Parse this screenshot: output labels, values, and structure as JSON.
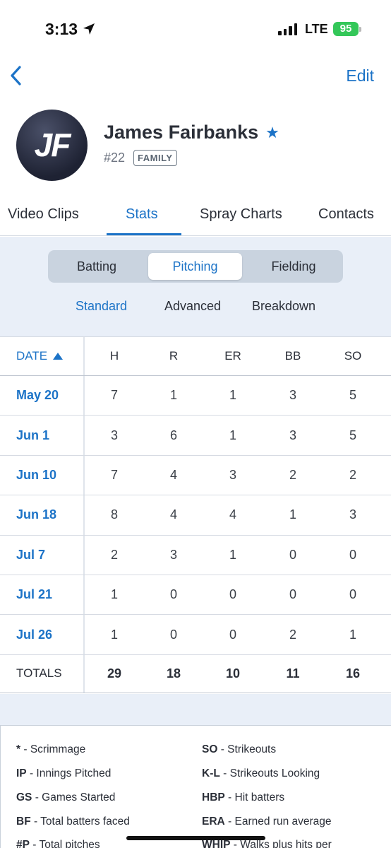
{
  "status_bar": {
    "time": "3:13",
    "network": "LTE",
    "battery": "95"
  },
  "nav": {
    "edit_label": "Edit"
  },
  "profile": {
    "initials": "JF",
    "name": "James Fairbanks",
    "jersey": "#22",
    "badge": "FAMILY"
  },
  "tabs": [
    "Video Clips",
    "Stats",
    "Spray Charts",
    "Contacts"
  ],
  "active_tab": "Stats",
  "segments": [
    "Batting",
    "Pitching",
    "Fielding"
  ],
  "active_segment": "Pitching",
  "sub_tabs": [
    "Standard",
    "Advanced",
    "Breakdown"
  ],
  "active_sub_tab": "Standard",
  "table": {
    "columns": [
      "DATE",
      "H",
      "R",
      "ER",
      "BB",
      "SO"
    ],
    "rows": [
      {
        "date": "May 20",
        "h": "7",
        "r": "1",
        "er": "1",
        "bb": "3",
        "so": "5"
      },
      {
        "date": "Jun 1",
        "h": "3",
        "r": "6",
        "er": "1",
        "bb": "3",
        "so": "5"
      },
      {
        "date": "Jun 10",
        "h": "7",
        "r": "4",
        "er": "3",
        "bb": "2",
        "so": "2"
      },
      {
        "date": "Jun 18",
        "h": "8",
        "r": "4",
        "er": "4",
        "bb": "1",
        "so": "3"
      },
      {
        "date": "Jul 7",
        "h": "2",
        "r": "3",
        "er": "1",
        "bb": "0",
        "so": "0"
      },
      {
        "date": "Jul 21",
        "h": "1",
        "r": "0",
        "er": "0",
        "bb": "0",
        "so": "0"
      },
      {
        "date": "Jul 26",
        "h": "1",
        "r": "0",
        "er": "0",
        "bb": "2",
        "so": "1"
      }
    ],
    "totals": {
      "label": "TOTALS",
      "h": "29",
      "r": "18",
      "er": "10",
      "bb": "11",
      "so": "16"
    }
  },
  "legend": [
    {
      "abbr": "*",
      "desc": " - Scrimmage"
    },
    {
      "abbr": "SO",
      "desc": " - Strikeouts"
    },
    {
      "abbr": "IP",
      "desc": " - Innings Pitched"
    },
    {
      "abbr": "K-L",
      "desc": " - Strikeouts Looking"
    },
    {
      "abbr": "GS",
      "desc": " - Games Started"
    },
    {
      "abbr": "HBP",
      "desc": " - Hit batters"
    },
    {
      "abbr": "BF",
      "desc": " - Total batters faced"
    },
    {
      "abbr": "ERA",
      "desc": " - Earned run average"
    },
    {
      "abbr": "#P",
      "desc": " - Total pitches"
    },
    {
      "abbr": "WHIP",
      "desc": " - Walks plus hits per"
    }
  ],
  "colors": {
    "accent": "#1c73c7",
    "panel_bg": "#e9eff8",
    "battery": "#34c759"
  },
  "icons": [
    "location-arrow-icon",
    "signal-icon",
    "battery-icon",
    "back-chevron-icon",
    "star-icon",
    "sort-ascending-icon"
  ]
}
